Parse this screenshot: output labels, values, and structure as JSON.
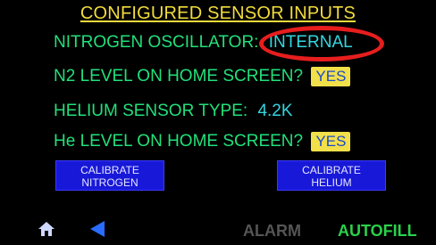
{
  "screen": {
    "title": "CONFIGURED SENSOR INPUTS",
    "rows": [
      {
        "label": "NITROGEN OSCILLATOR:",
        "value": "INTERNAL"
      },
      {
        "label": "N2 LEVEL ON HOME SCREEN?",
        "value": "YES"
      },
      {
        "label": "HELIUM SENSOR TYPE:",
        "value": "4.2K"
      },
      {
        "label": "He LEVEL ON HOME SCREEN?",
        "value": "YES"
      }
    ],
    "buttons": {
      "calibrate_nitrogen": [
        "CALIBRATE",
        "NITROGEN"
      ],
      "calibrate_helium": [
        "CALIBRATE",
        "HELIUM"
      ]
    },
    "footer": {
      "alarm": "ALARM",
      "autofill": "AUTOFILL"
    },
    "icons": {
      "home": "home-icon",
      "back": "back-arrow-icon"
    },
    "colors": {
      "background": "#000000",
      "title": "#f2dc3c",
      "label": "#22e07a",
      "value": "#33d6e0",
      "yes_bg": "#f2e04a",
      "button_bg": "#1818d8",
      "highlight_oval": "#e61e1e"
    }
  }
}
